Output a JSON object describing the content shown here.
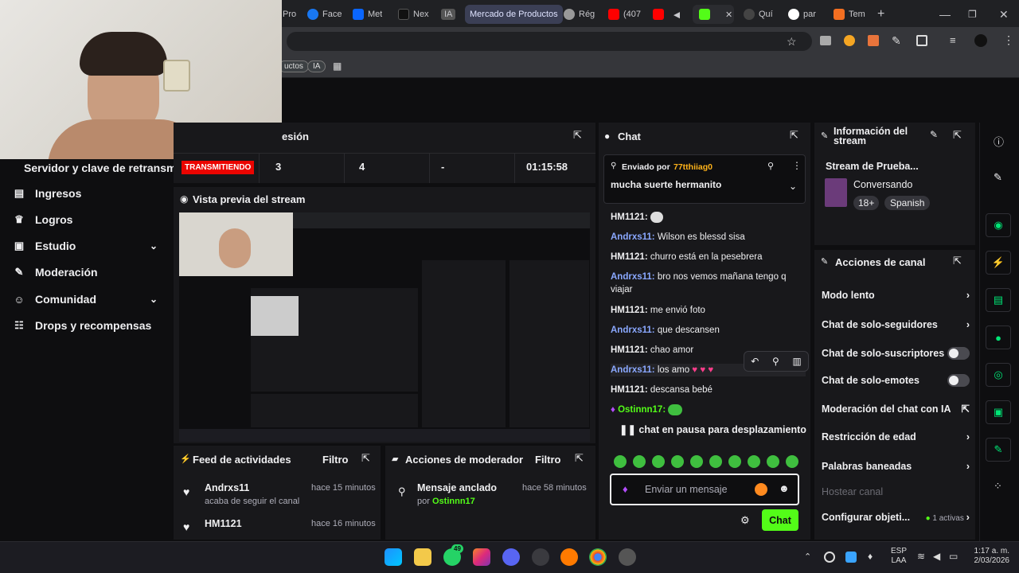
{
  "browser": {
    "tabs": [
      "Pro",
      "Face",
      "Met",
      "Nex",
      "IA",
      "Mercado de Productos",
      "Rég",
      "(407",
      "",
      "",
      "Quí",
      "par",
      "Tem"
    ],
    "new_tab": "+",
    "bookmarks": [
      "uctos",
      "IA"
    ]
  },
  "sidebar": {
    "server_key": "Servidor y clave de retransm",
    "items": [
      {
        "label": "Ingresos",
        "icon": "dollar-icon"
      },
      {
        "label": "Logros",
        "icon": "trophy-icon"
      },
      {
        "label": "Estudio",
        "icon": "film-icon",
        "chevron": true
      },
      {
        "label": "Moderación",
        "icon": "wrench-icon"
      },
      {
        "label": "Comunidad",
        "icon": "users-icon",
        "chevron": true
      },
      {
        "label": "Drops y recompensas",
        "icon": "gift-icon"
      }
    ]
  },
  "session": {
    "title": "esión",
    "status_badge": "TRANSMITIENDO",
    "stat1": "3",
    "stat2": "4",
    "stat3": "-",
    "time": "01:15:58"
  },
  "preview": {
    "title": "Vista previa del stream"
  },
  "activity": {
    "title": "Feed de actividades",
    "filter": "Filtro",
    "items": [
      {
        "user": "Andrxs11",
        "action": "acaba de seguir el canal",
        "time": "hace 15 minutos"
      },
      {
        "user": "HM1121",
        "action": "",
        "time": "hace 16 minutos"
      }
    ]
  },
  "mod_actions": {
    "title": "Acciones de moderador",
    "filter": "Filtro",
    "items": [
      {
        "title": "Mensaje anclado",
        "by_label": "por",
        "by_user": "Ostinnn17",
        "time": "hace 58 minutos"
      }
    ]
  },
  "chat": {
    "title": "Chat",
    "pinned_prefix": "Enviado por",
    "pinned_user": "77tthiiag0",
    "pinned_message": "mucha suerte hermanito",
    "messages": [
      {
        "user": "HM1121",
        "text": ""
      },
      {
        "user": "Andrxs11",
        "text": "Wilson es blessd sisa"
      },
      {
        "user": "HM1121",
        "text": "churro está en la pesebrera"
      },
      {
        "user": "Andrxs11",
        "text": "bro nos vemos mañana tengo q viajar"
      },
      {
        "user": "HM1121",
        "text": "me envió foto"
      },
      {
        "user": "Andrxs11",
        "text": "que descansen"
      },
      {
        "user": "HM1121",
        "text": "chao amor"
      },
      {
        "user": "Andrxs11",
        "text": "los amo"
      },
      {
        "user": "HM1121",
        "text": "descansa bebé"
      },
      {
        "user": "Ostinnn17",
        "text": ""
      }
    ],
    "paused": "chat en pausa para desplazamiento",
    "input_placeholder": "Enviar un mensaje",
    "send_label": "Chat"
  },
  "stream_info": {
    "title": "Información del stream",
    "stream_title": "Stream de Prueba...",
    "category": "Conversando",
    "tags": [
      "18+",
      "Spanish"
    ]
  },
  "channel_actions": {
    "title": "Acciones de canal",
    "rows": [
      {
        "label": "Modo lento",
        "control": "chevron"
      },
      {
        "label": "Chat de solo-seguidores",
        "control": "chevron"
      },
      {
        "label": "Chat de solo-suscriptores",
        "control": "toggle"
      },
      {
        "label": "Chat de solo-emotes",
        "control": "toggle"
      },
      {
        "label": "Moderación del chat con IA",
        "control": "external"
      },
      {
        "label": "Restricción de edad",
        "control": "chevron"
      },
      {
        "label": "Palabras baneadas",
        "control": "chevron"
      }
    ],
    "host": "Hostear canal",
    "goals": "Configurar objeti...",
    "goals_status": "1 activas"
  },
  "taskbar": {
    "lang": "ESP",
    "region": "LAA",
    "time": "1:17 a. m.",
    "date": "2/03/2026",
    "badge": "49"
  },
  "colors": {
    "accent_green": "#00e676",
    "badge_red": "#eb0400",
    "chat_user_blue": "#8aa8ff",
    "pinned_orange": "#ffb31a",
    "panel_bg": "#18181b"
  }
}
